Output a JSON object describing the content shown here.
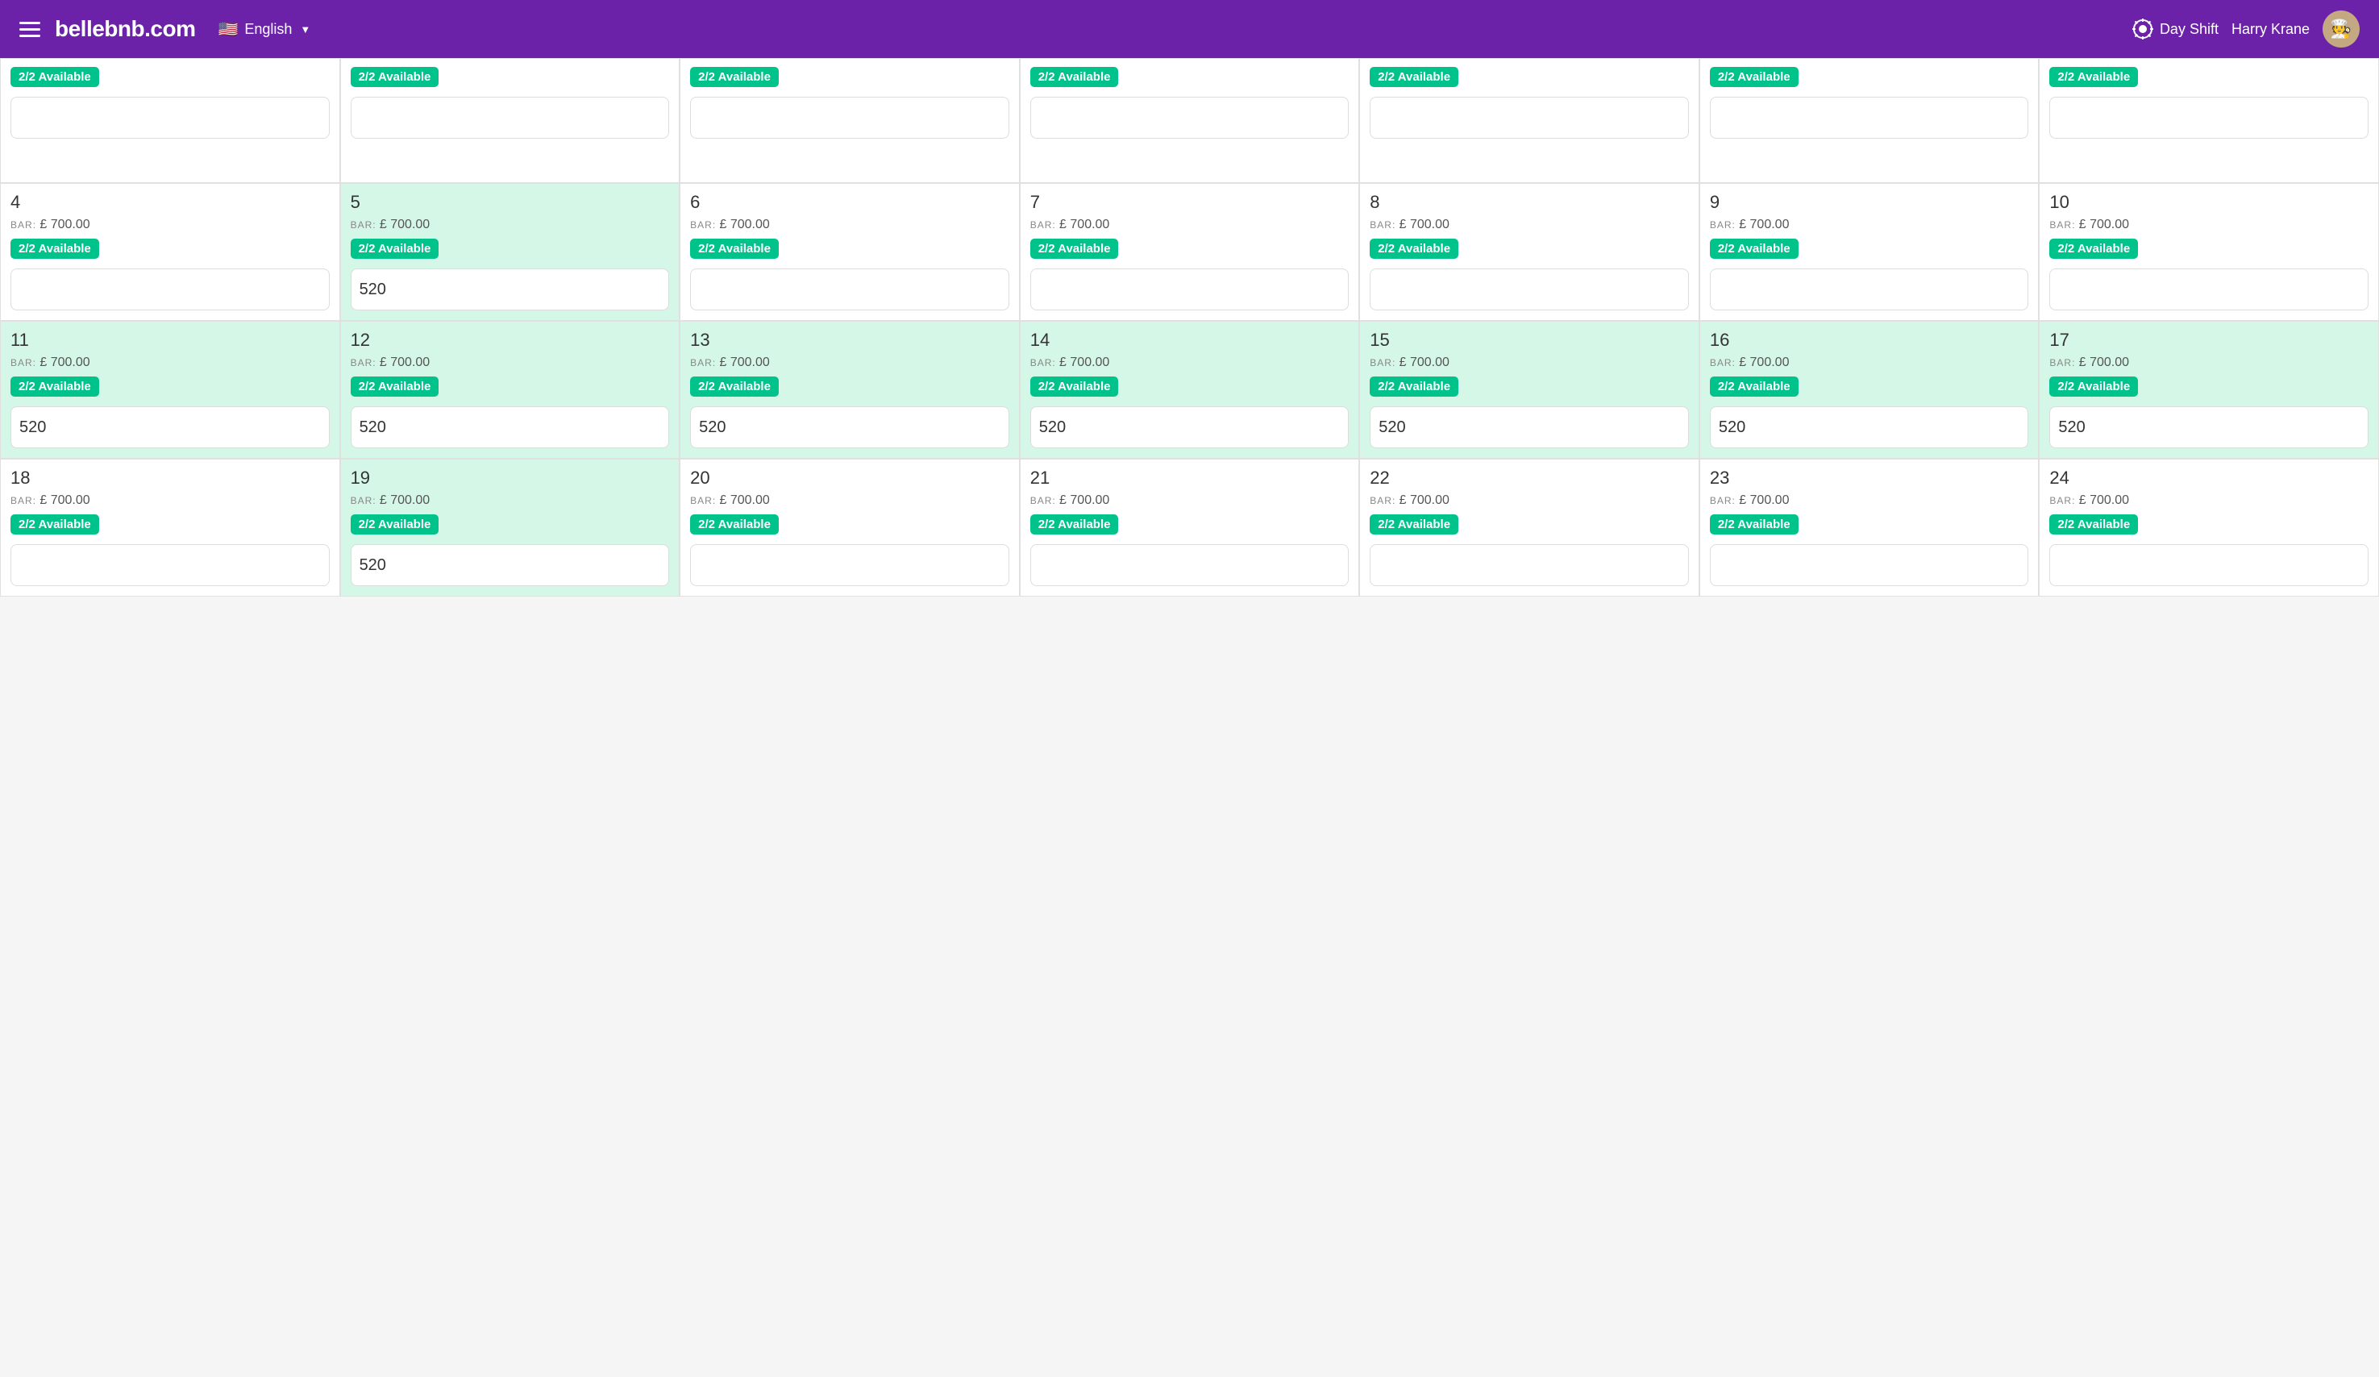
{
  "header": {
    "logo": "bellebnb.com",
    "lang_label": "English",
    "day_shift_label": "Day Shift",
    "user_name": "Harry Krane"
  },
  "grid": {
    "bar_prefix": "BAR: £",
    "bar_price": "700.00",
    "available_label": "2/2 Available",
    "rows": [
      {
        "id": "row0",
        "cells": [
          {
            "day": "",
            "has_badge": true,
            "price_value": ""
          },
          {
            "day": "",
            "has_badge": true,
            "price_value": ""
          },
          {
            "day": "",
            "has_badge": true,
            "price_value": ""
          },
          {
            "day": "",
            "has_badge": true,
            "price_value": ""
          },
          {
            "day": "",
            "has_badge": true,
            "price_value": ""
          },
          {
            "day": "",
            "has_badge": true,
            "price_value": ""
          },
          {
            "day": "",
            "has_badge": true,
            "price_value": ""
          }
        ]
      },
      {
        "id": "row1",
        "cells": [
          {
            "day": "4",
            "has_badge": true,
            "price_value": "",
            "green": false
          },
          {
            "day": "5",
            "has_badge": true,
            "price_value": "520",
            "green": true
          },
          {
            "day": "6",
            "has_badge": true,
            "price_value": "",
            "green": false
          },
          {
            "day": "7",
            "has_badge": true,
            "price_value": "",
            "green": false
          },
          {
            "day": "8",
            "has_badge": true,
            "price_value": "",
            "green": false
          },
          {
            "day": "9",
            "has_badge": true,
            "price_value": "",
            "green": false
          },
          {
            "day": "10",
            "has_badge": true,
            "price_value": "",
            "green": false
          }
        ]
      },
      {
        "id": "row2",
        "cells": [
          {
            "day": "11",
            "has_badge": true,
            "price_value": "520",
            "green": true
          },
          {
            "day": "12",
            "has_badge": true,
            "price_value": "520",
            "green": true
          },
          {
            "day": "13",
            "has_badge": true,
            "price_value": "520",
            "green": true
          },
          {
            "day": "14",
            "has_badge": true,
            "price_value": "520",
            "green": true
          },
          {
            "day": "15",
            "has_badge": true,
            "price_value": "520",
            "green": true
          },
          {
            "day": "16",
            "has_badge": true,
            "price_value": "520",
            "green": true
          },
          {
            "day": "17",
            "has_badge": true,
            "price_value": "520",
            "green": true
          }
        ]
      },
      {
        "id": "row3",
        "cells": [
          {
            "day": "18",
            "has_badge": true,
            "price_value": "",
            "green": false
          },
          {
            "day": "19",
            "has_badge": true,
            "price_value": "520",
            "green": true
          },
          {
            "day": "20",
            "has_badge": true,
            "price_value": "",
            "green": false
          },
          {
            "day": "21",
            "has_badge": true,
            "price_value": "",
            "green": false
          },
          {
            "day": "22",
            "has_badge": true,
            "price_value": "",
            "green": false
          },
          {
            "day": "23",
            "has_badge": true,
            "price_value": "",
            "green": false
          },
          {
            "day": "24",
            "has_badge": true,
            "price_value": "",
            "green": false
          }
        ]
      }
    ]
  }
}
